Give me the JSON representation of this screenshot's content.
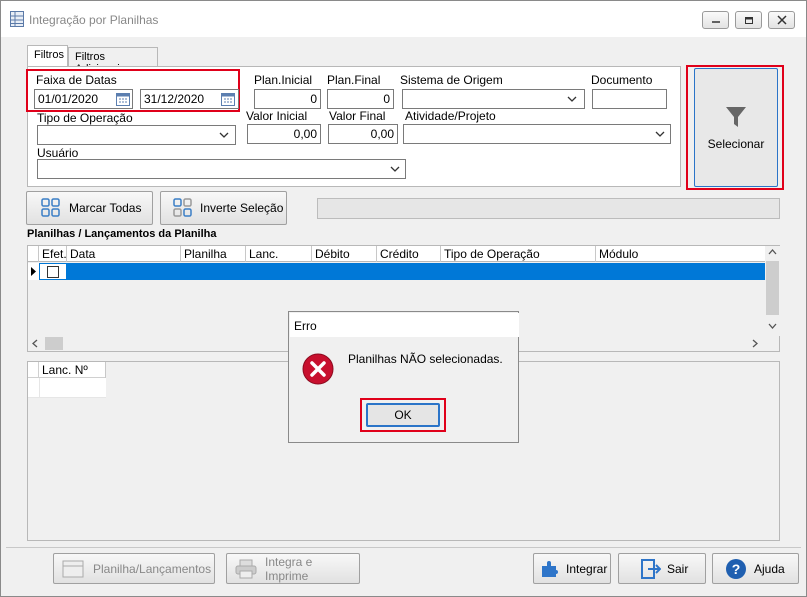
{
  "window": {
    "title": "Integração por Planilhas",
    "controls": [
      "minimize",
      "restore",
      "close"
    ]
  },
  "tabs": [
    {
      "label": "Filtros"
    },
    {
      "label": "Filtros Adicionais"
    }
  ],
  "filters": {
    "date_range_label": "Faixa de Datas",
    "date_from": "01/01/2020",
    "date_to": "31/12/2020",
    "plan_inicial_label": "Plan.Inicial",
    "plan_inicial_value": "0",
    "plan_final_label": "Plan.Final",
    "plan_final_value": "0",
    "sistema_origem_label": "Sistema de Origem",
    "sistema_origem_value": "",
    "documento_label": "Documento",
    "documento_value": "",
    "tipo_operacao_label": "Tipo de Operação",
    "tipo_operacao_value": "",
    "valor_inicial_label": "Valor Inicial",
    "valor_inicial_value": "0,00",
    "valor_final_label": "Valor Final",
    "valor_final_value": "0,00",
    "atividade_label": "Atividade/Projeto",
    "atividade_value": "",
    "usuario_label": "Usuário",
    "usuario_value": ""
  },
  "select_button": {
    "label": "Selecionar",
    "icon": "funnel-icon"
  },
  "toolbar": {
    "mark_all": "Marcar Todas",
    "invert": "Inverte Seleção"
  },
  "grid1": {
    "title": "Planilhas / Lançamentos da Planilha",
    "columns": [
      "Efet.",
      "Data",
      "Planilha",
      "Lanc.",
      "Débito",
      "Crédito",
      "Tipo de Operação",
      "Módulo"
    ],
    "row_checked": false
  },
  "grid2": {
    "columns": [
      "Lanc. Nº"
    ]
  },
  "dialog": {
    "title": "Erro",
    "message": "Planilhas NÃO selecionadas.",
    "ok": "OK",
    "icon": "error-icon"
  },
  "footer": {
    "planilha": "Planilha/Lançamentos",
    "integra_imprime": "Integra e Imprime",
    "integrar": "Integrar",
    "sair": "Sair",
    "ajuda": "Ajuda"
  },
  "colors": {
    "selection": "#0078d7",
    "highlight_border": "#e0001a",
    "error": "#c8102e"
  }
}
